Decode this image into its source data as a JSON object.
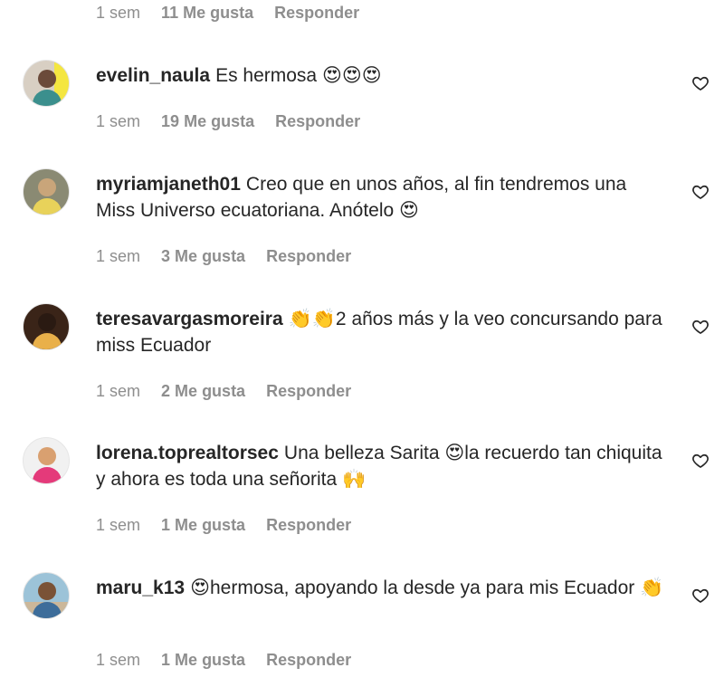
{
  "top_meta": {
    "time": "1 sem",
    "likes": "11 Me gusta",
    "reply": "Responder"
  },
  "comments": [
    {
      "username": "evelin_naula",
      "text": "Es hermosa 😍😍😍",
      "time": "1 sem",
      "likes": "19 Me gusta",
      "reply": "Responder",
      "avatar_colors": {
        "bg": "#d8cfc3",
        "head": "#6b4a3a",
        "body": "#3b8f8d",
        "accent": "#f4e640"
      }
    },
    {
      "username": "myriamjaneth01",
      "text": "Creo que en unos años, al fin tendremos una Miss Universo ecuatoriana. Anótelo 😍",
      "time": "1 sem",
      "likes": "3 Me gusta",
      "reply": "Responder",
      "avatar_colors": {
        "bg": "#8a8a73",
        "head": "#c9a57a",
        "body": "#e8d25a"
      }
    },
    {
      "username": "teresavargasmoreira",
      "text": "👏👏2 años más y la veo concursando para miss Ecuador",
      "time": "1 sem",
      "likes": "2 Me gusta",
      "reply": "Responder",
      "avatar_colors": {
        "bg": "#3a2418",
        "head": "#2a1a12",
        "body": "#e9b04a"
      }
    },
    {
      "username": "lorena.toprealtorsec",
      "text": "Una belleza Sarita 😍la recuerdo tan chiquita y ahora es toda una señorita 🙌",
      "time": "1 sem",
      "likes": "1 Me gusta",
      "reply": "Responder",
      "avatar_colors": {
        "bg": "#f1f1f1",
        "head": "#d9a070",
        "body": "#e43a7a"
      }
    },
    {
      "username": "maru_k13",
      "text": "😍hermosa, apoyando la desde ya para mis Ecuador 👏",
      "time": "1 sem",
      "likes": "1 Me gusta",
      "reply": "Responder",
      "avatar_colors": {
        "bg": "#9cc3d8",
        "head": "#7a5236",
        "body": "#3d6d9a"
      }
    }
  ],
  "icons": {
    "like": "heart-outline-icon"
  }
}
